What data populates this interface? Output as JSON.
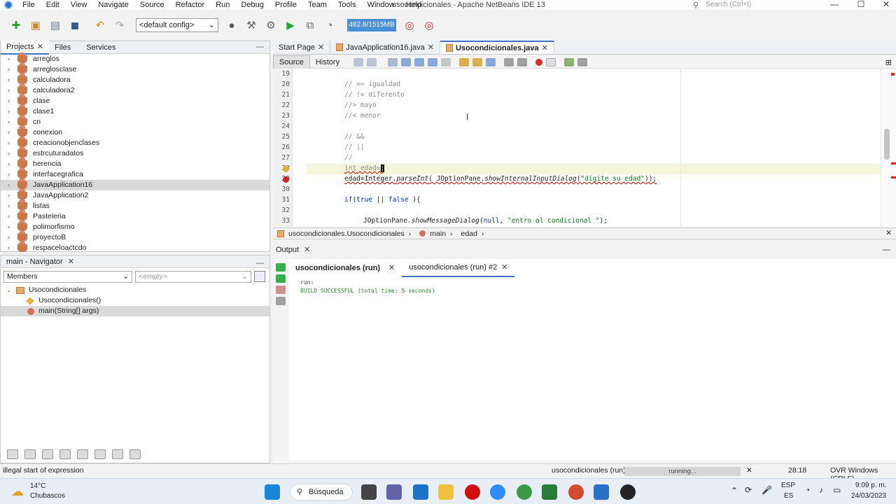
{
  "window": {
    "title": "usocondicionales - Apache NetBeans IDE 13",
    "menu": [
      "File",
      "Edit",
      "View",
      "Navigate",
      "Source",
      "Refactor",
      "Run",
      "Debug",
      "Profile",
      "Team",
      "Tools",
      "Window",
      "Help"
    ],
    "search_placeholder": "Search (Ctrl+I)",
    "controls": {
      "minimize": "—",
      "maximize": "☐",
      "close": "✕"
    }
  },
  "toolbar": {
    "config": "<default config>",
    "memory": "482.8/1515MB"
  },
  "projects_panel": {
    "tabs": [
      "Projects",
      "Files",
      "Services"
    ],
    "items": [
      "arreglos",
      "arreglosclase",
      "calculadora",
      "calculadora2",
      "clase",
      "clase1",
      "cn",
      "conexion",
      "creacionobjenclases",
      "estrcuturadatos",
      "herencia",
      "interfacegrafica",
      "JavaApplication16",
      "JavaApplication2",
      "listas",
      "Pasteleria",
      "polimorfismo",
      "proyectoB",
      "respaceloactcdo"
    ],
    "selected": "JavaApplication16"
  },
  "navigator": {
    "title": "main - Navigator",
    "filter": "Members",
    "filter2": "<empty>",
    "tree": {
      "class": "Usocondicionales",
      "members": [
        "Usocondicionales()",
        "main(String[] args)"
      ]
    }
  },
  "editor": {
    "tabs": [
      "Start Page",
      "JavaApplication16.java",
      "Usocondicionales.java"
    ],
    "active_tab": "Usocondicionales.java",
    "view_tabs": [
      "Source",
      "History"
    ],
    "line_numbers": [
      "19",
      "20",
      "21",
      "22",
      "23",
      "24",
      "25",
      "26",
      "27",
      "28",
      "29",
      "30",
      "31",
      "32",
      "33"
    ],
    "lines": {
      "l20": "// == igualdad",
      "l21": "// != diferento",
      "l22": "//> mayo",
      "l23": "//< menor",
      "l25": "// &&",
      "l26": "// ||",
      "l27": "//",
      "l28_kw": "int",
      "l28_rest": " edad=",
      "l29_a": "edad=Integer.",
      "l29_b": "parseInt",
      "l29_c": "( JOptionPane.",
      "l29_d": "showInternalInputDialog",
      "l29_e": "(",
      "l29_str": "\"digite su edad\"",
      "l29_f": "));",
      "l31_kw": "if",
      "l31_a": "(",
      "l31_true": "true",
      "l31_b": " || ",
      "l31_false": "false",
      "l31_c": " ){",
      "l33_a": "JOptionPane.",
      "l33_b": "showMessageDialog",
      "l33_c": "(",
      "l33_null": "null",
      "l33_d": ", ",
      "l33_str": "\"entro al condicional \"",
      "l33_e": ");"
    },
    "breadcrumb": [
      "usocondicionales.Usocondicionales",
      "main",
      "edad"
    ]
  },
  "output": {
    "title": "Output",
    "tabs": [
      "usocondicionales (run)",
      "usocondicionales (run) #2"
    ],
    "lines": [
      "run:",
      "BUILD SUCCESSFUL (total time: 5 seconds)"
    ]
  },
  "statusbar": {
    "message": "illegal start of expression",
    "task": "usocondicionales (run)",
    "progress_text": "running...",
    "position": "28:18",
    "mode": "OVR Windows (CRLF)"
  },
  "taskbar": {
    "weather_temp": "14°C",
    "weather_desc": "Chubascos",
    "search": "Búsqueda",
    "lang_top": "ESP",
    "lang_bottom": "ES",
    "time": "9:09 p. m.",
    "date": "24/03/2023"
  },
  "colors": {
    "accent": "#3c74c9",
    "memory_bar": "#4a8fd6",
    "current_line": "#f5f5dc",
    "error": "#e00000"
  }
}
